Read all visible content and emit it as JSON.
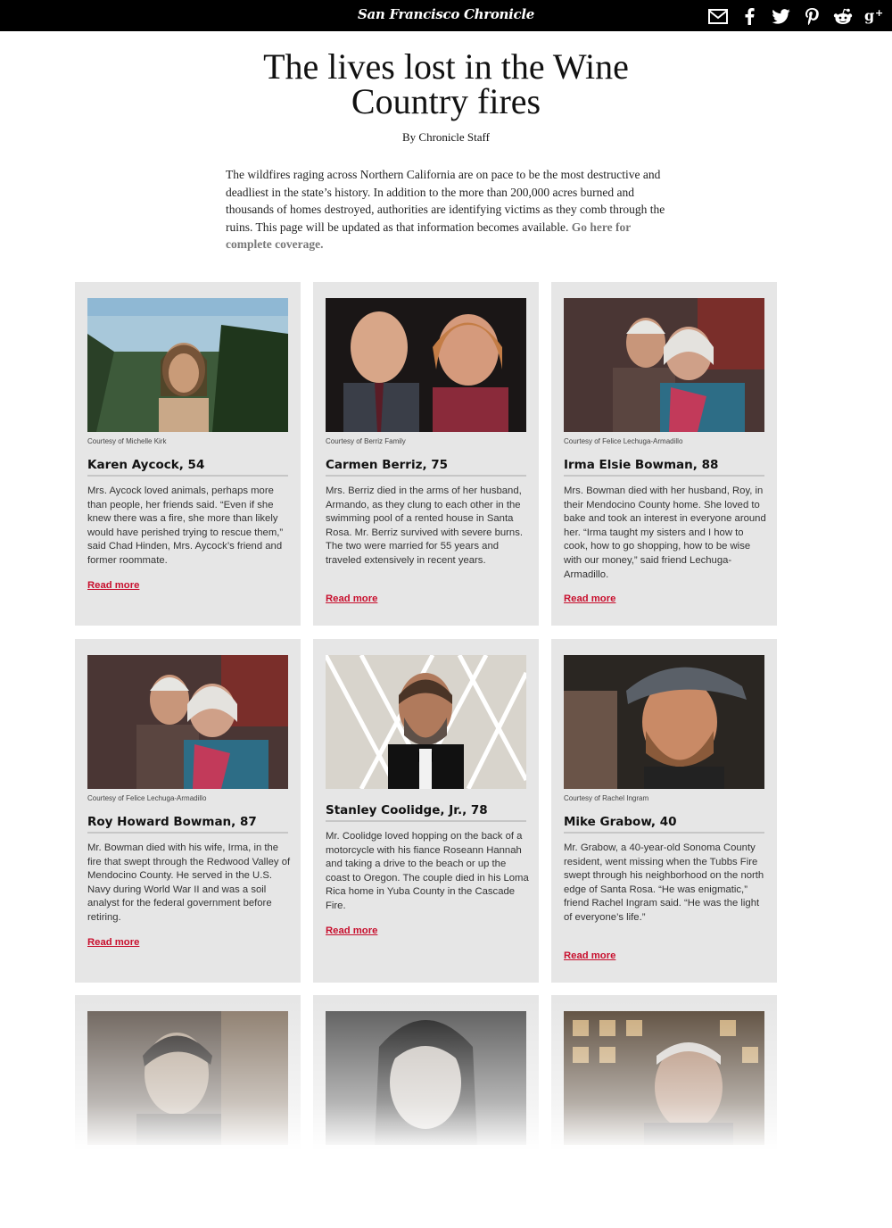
{
  "header": {
    "masthead": "San Francisco Chronicle",
    "share_icons": [
      "email-icon",
      "facebook-icon",
      "twitter-icon",
      "pinterest-icon",
      "reddit-icon",
      "google-plus-icon"
    ]
  },
  "article": {
    "headline": "The lives lost in the Wine Country fires",
    "byline": "By Chronicle Staff",
    "intro": "The wildfires raging across Northern California are on pace to be the most destructive and deadliest in the state’s history. In addition to the more than 200,000 acres burned and thousands of homes destroyed, authorities are identifying victims as they comb through the ruins. This page will be updated as that information becomes available.",
    "intro_link": "Go here for complete coverage."
  },
  "colors": {
    "accent": "#c8102e",
    "card_bg": "#e6e6e6",
    "topbar": "#000000"
  },
  "cards": [
    {
      "credit": "Courtesy of Michelle Kirk",
      "name": "Karen Aycock, 54",
      "description": "Mrs. Aycock loved animals, perhaps more than people, her friends said. “Even if she knew there was a fire, she more than likely would have perished trying to rescue them,” said Chad Hinden, Mrs. Aycock’s friend and former roommate.",
      "link": "Read more"
    },
    {
      "credit": "Courtesy of Berriz Family",
      "name": "Carmen Berriz, 75",
      "description": "Mrs. Berriz died in the arms of her husband, Armando, as they clung to each other in the swimming pool of a rented house in Santa Rosa. Mr. Berriz survived with severe burns. The two were married for 55 years and traveled extensively in recent years.",
      "link": "Read more"
    },
    {
      "credit": "Courtesy of Felice Lechuga-Armadillo",
      "name": "Irma Elsie Bowman, 88",
      "description": "Mrs. Bowman died with her husband, Roy, in their Mendocino County home. She loved to bake and took an interest in everyone around her. “Irma taught my sisters and I how to cook, how to go shopping, how to be wise with our money,” said friend Lechuga-Armadillo.",
      "link": "Read more"
    },
    {
      "credit": "Courtesy of Felice Lechuga-Armadillo",
      "name": "Roy Howard Bowman, 87",
      "description": "Mr. Bowman died with his wife, Irma, in the fire that swept through the Redwood Valley of Mendocino County. He served in the U.S. Navy during World War II and was a soil analyst for the federal government before retiring.",
      "link": "Read more"
    },
    {
      "credit": "",
      "name": "Stanley Coolidge, Jr., 78",
      "description": "Mr. Coolidge loved hopping on the back of a motorcycle with his fiance Roseann Hannah and taking a drive to the beach or up the coast to Oregon. The couple died in his Loma Rica home in Yuba County in the Cascade Fire.",
      "link": "Read more"
    },
    {
      "credit": "Courtesy of Rachel Ingram",
      "name": "Mike Grabow, 40",
      "description": "Mr. Grabow, a 40-year-old Sonoma County resident, went missing when the Tubbs Fire swept through his neighborhood on the north edge of Santa Rosa. “He was enigmatic,” friend Rachel Ingram said. “He was the light of everyone’s life.”",
      "link": "Read more"
    }
  ]
}
